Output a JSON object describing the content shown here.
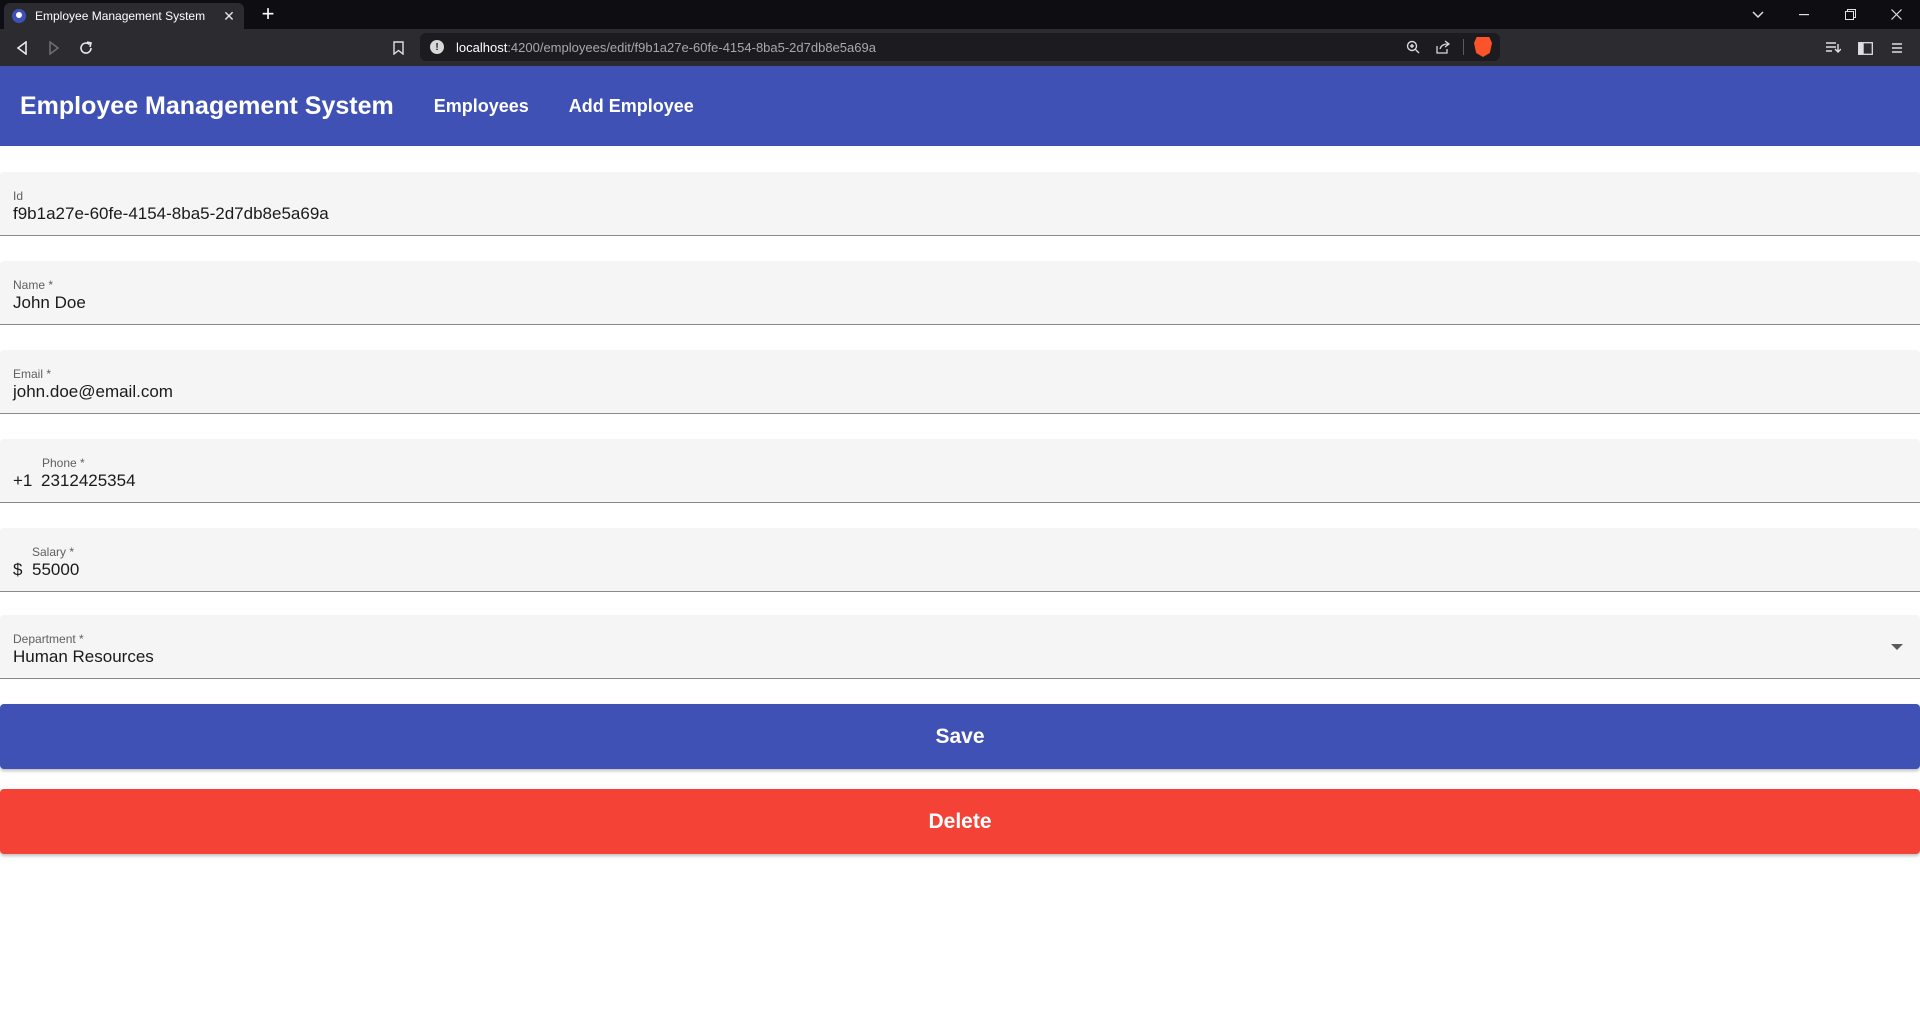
{
  "browser": {
    "tab_title": "Employee Management System",
    "tab_close": "✕",
    "new_tab": "+",
    "url_host": "localhost",
    "url_path": ":4200/employees/edit/f9b1a27e-60fe-4154-8ba5-2d7db8e5a69a"
  },
  "header": {
    "title": "Employee Management System",
    "nav": [
      "Employees",
      "Add Employee"
    ]
  },
  "form": {
    "id": {
      "label": "Id",
      "value": "f9b1a27e-60fe-4154-8ba5-2d7db8e5a69a"
    },
    "name": {
      "label": "Name *",
      "value": "John Doe"
    },
    "email": {
      "label": "Email *",
      "value": "john.doe@email.com"
    },
    "phone": {
      "label": "Phone *",
      "prefix": "+1",
      "value": "2312425354"
    },
    "salary": {
      "label": "Salary *",
      "prefix": "$",
      "value": "55000"
    },
    "department": {
      "label": "Department *",
      "value": "Human Resources"
    }
  },
  "buttons": {
    "save": "Save",
    "delete": "Delete"
  },
  "colors": {
    "primary": "#3f51b5",
    "warn": "#f44336"
  }
}
